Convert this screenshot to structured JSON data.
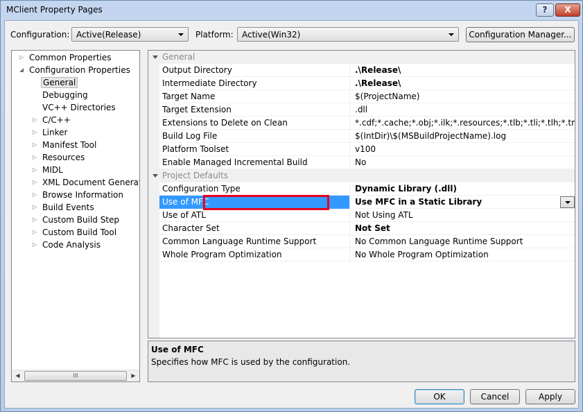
{
  "window": {
    "title": "MClient Property Pages",
    "help_label": "?",
    "close_label": "X"
  },
  "toolbar": {
    "configuration_label": "Configuration:",
    "configuration_value": "Active(Release)",
    "platform_label": "Platform:",
    "platform_value": "Active(Win32)",
    "config_manager_label": "Configuration Manager..."
  },
  "tree": {
    "items": [
      {
        "label": "Common Properties",
        "expander": "▷"
      },
      {
        "label": "Configuration Properties",
        "expander": "◢"
      },
      {
        "label": "General"
      },
      {
        "label": "Debugging"
      },
      {
        "label": "VC++ Directories"
      },
      {
        "label": "C/C++",
        "expander": "▷"
      },
      {
        "label": "Linker",
        "expander": "▷"
      },
      {
        "label": "Manifest Tool",
        "expander": "▷"
      },
      {
        "label": "Resources",
        "expander": "▷"
      },
      {
        "label": "MIDL",
        "expander": "▷"
      },
      {
        "label": "XML Document Generator",
        "expander": "▷"
      },
      {
        "label": "Browse Information",
        "expander": "▷"
      },
      {
        "label": "Build Events",
        "expander": "▷"
      },
      {
        "label": "Custom Build Step",
        "expander": "▷"
      },
      {
        "label": "Custom Build Tool",
        "expander": "▷"
      },
      {
        "label": "Code Analysis",
        "expander": "▷"
      }
    ],
    "scroll_left": "◀",
    "scroll_right": "▶",
    "thumb_grip": "III"
  },
  "grid": {
    "categories": [
      {
        "label": "General"
      },
      {
        "label": "Project Defaults"
      }
    ],
    "general_rows": [
      {
        "name": "Output Directory",
        "value": ".\\Release\\"
      },
      {
        "name": "Intermediate Directory",
        "value": ".\\Release\\"
      },
      {
        "name": "Target Name",
        "value": "$(ProjectName)"
      },
      {
        "name": "Target Extension",
        "value": ".dll"
      },
      {
        "name": "Extensions to Delete on Clean",
        "value": "*.cdf;*.cache;*.obj;*.ilk;*.resources;*.tlb;*.tli;*.tlh;*.tmp;*.rsp;*.pgc;*.pgd;*.meta;"
      },
      {
        "name": "Build Log File",
        "value": "$(IntDir)\\$(MSBuildProjectName).log"
      },
      {
        "name": "Platform Toolset",
        "value": "v100"
      },
      {
        "name": "Enable Managed Incremental Build",
        "value": "No"
      }
    ],
    "defaults_rows": [
      {
        "name": "Configuration Type",
        "value": "Dynamic Library (.dll)"
      },
      {
        "name": "Use of MFC",
        "value": "Use MFC in a Static Library"
      },
      {
        "name": "Use of ATL",
        "value": "Not Using ATL"
      },
      {
        "name": "Character Set",
        "value": "Not Set"
      },
      {
        "name": "Common Language Runtime Support",
        "value": "No Common Language Runtime Support"
      },
      {
        "name": "Whole Program Optimization",
        "value": "No Whole Program Optimization"
      }
    ]
  },
  "description": {
    "title": "Use of MFC",
    "text": "Specifies how MFC is used by the configuration."
  },
  "buttons": {
    "ok": "OK",
    "cancel": "Cancel",
    "apply": "Apply"
  },
  "colors": {
    "selection": "#3399ff",
    "highlight_border": "#e8001c"
  }
}
